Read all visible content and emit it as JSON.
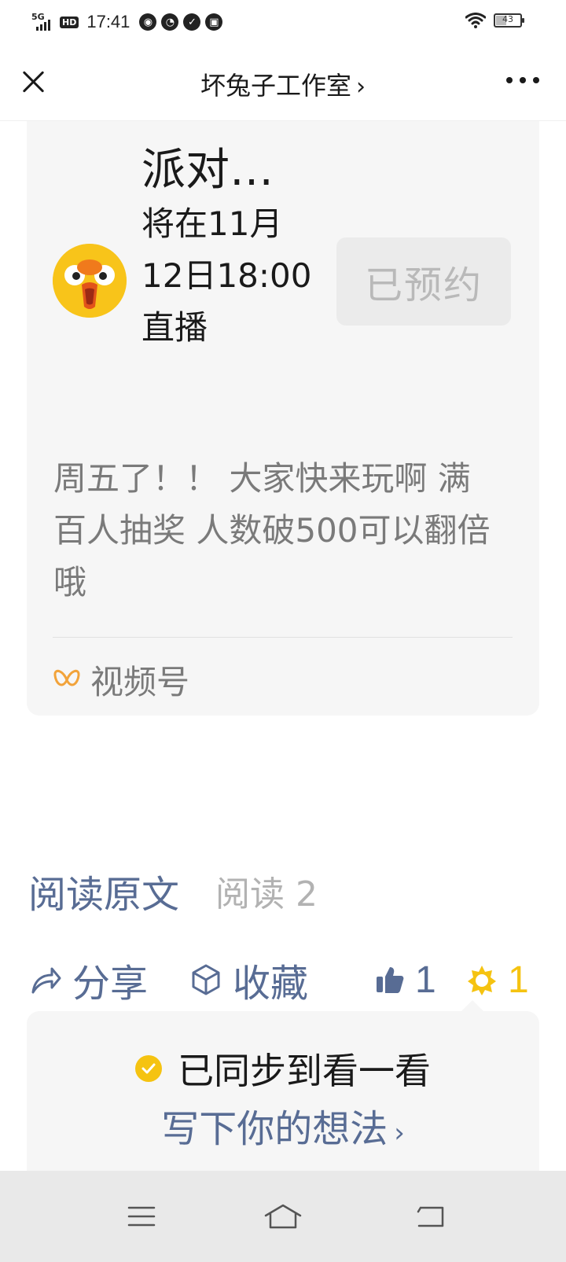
{
  "status_bar": {
    "network": "5G",
    "hd": "HD",
    "time": "17:41",
    "battery": "43"
  },
  "nav": {
    "title": "坏兔子工作室",
    "title_chevron": "›"
  },
  "live_card": {
    "title": "派对…",
    "schedule": "将在11月12日18:00 直播",
    "reserve_label": "已预约",
    "description": "周五了！！ 大家快来玩啊 满百人抽奖 人数破500可以翻倍哦",
    "source_label": "视频号"
  },
  "read": {
    "original_label": "阅读原文",
    "count_label": "阅读 2"
  },
  "actions": {
    "share_label": "分享",
    "favorite_label": "收藏",
    "like_count": "1",
    "wow_count": "1"
  },
  "sync": {
    "status_text": "已同步到看一看",
    "write_label": "写下你的想法",
    "write_chevron": "›"
  },
  "colors": {
    "link_blue": "#586c94",
    "gold": "#f5c311",
    "card_bg": "#f6f6f6",
    "muted_text": "#7a7a7a"
  },
  "icons": [
    "close-icon",
    "chevron-right-icon",
    "more-icon",
    "channels-icon",
    "share-icon",
    "favorite-icon",
    "like-icon",
    "wow-icon",
    "check-icon",
    "menu-icon",
    "home-icon",
    "back-icon"
  ]
}
